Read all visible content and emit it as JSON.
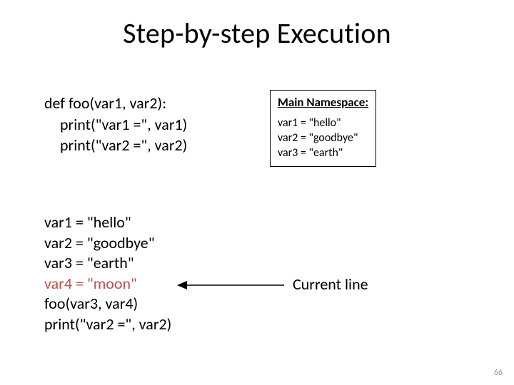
{
  "title": "Step-by-step Execution",
  "code_top": {
    "l1": "def foo(var1, var2):",
    "l2": "print(\"var1 =\", var1)",
    "l3": "print(\"var2 =\", var2)"
  },
  "namespace": {
    "heading": "Main Namespace:",
    "l1": "var1 = \"hello\"",
    "l2": "var2 = \"goodbye\"",
    "l3": "var3 = \"earth\""
  },
  "code_bottom": {
    "l1": "var1 = \"hello\"",
    "l2": "var2 = \"goodbye\"",
    "l3": "var3 = \"earth\"",
    "l4": "var4 = \"moon\"",
    "l5": "foo(var3, var4)",
    "l6": "print(\"var2 =\", var2)"
  },
  "current_line_label": "Current line",
  "page_number": "66"
}
